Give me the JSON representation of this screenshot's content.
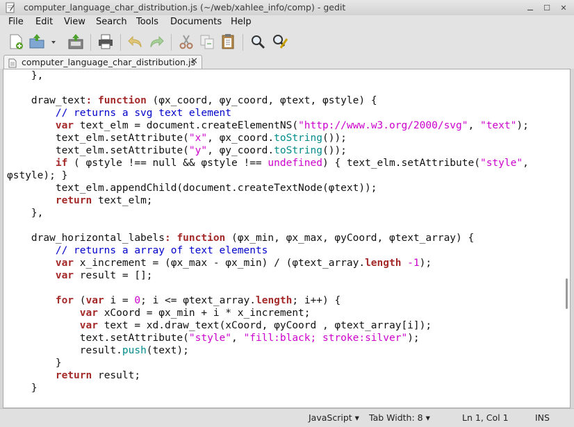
{
  "window": {
    "title": "computer_language_char_distribution.js (~/web/xahlee_info/comp) - gedit",
    "controls": {
      "minimize": "⚊",
      "maximize": "☐",
      "close": "✕"
    }
  },
  "menu": [
    "File",
    "Edit",
    "View",
    "Search",
    "Tools",
    "Documents",
    "Help"
  ],
  "toolbar": {
    "icons": [
      "new-document-icon",
      "open-icon",
      "dropdown-arrow-icon",
      "save-icon",
      "print-icon",
      "undo-icon",
      "redo-icon",
      "cut-icon",
      "copy-icon",
      "paste-icon",
      "find-icon",
      "find-replace-icon"
    ]
  },
  "tab": {
    "label": "computer_language_char_distribution.js",
    "close": "✕"
  },
  "code_lines": [
    [
      [
        "",
        "    },"
      ]
    ],
    [
      [
        "",
        ""
      ]
    ],
    [
      [
        "",
        "    draw_text"
      ],
      [
        "kw",
        ": function"
      ],
      [
        "",
        " (φx_coord, φy_coord, φtext, φstyle) {"
      ]
    ],
    [
      [
        "",
        "        "
      ],
      [
        "com",
        "// returns a svg text element"
      ]
    ],
    [
      [
        "",
        "        "
      ],
      [
        "kw",
        "var"
      ],
      [
        "",
        " text_elm = document.createElementNS("
      ],
      [
        "str",
        "\"http://www.w3.org/2000/svg\""
      ],
      [
        "",
        ", "
      ],
      [
        "str",
        "\"text\""
      ],
      [
        "",
        ");"
      ]
    ],
    [
      [
        "",
        "        text_elm.setAttribute("
      ],
      [
        "str",
        "\"x\""
      ],
      [
        "",
        ", φx_coord."
      ],
      [
        "prop",
        "toString"
      ],
      [
        "",
        "());"
      ]
    ],
    [
      [
        "",
        "        text_elm.setAttribute("
      ],
      [
        "str",
        "\"y\""
      ],
      [
        "",
        ", φy_coord."
      ],
      [
        "prop",
        "toString"
      ],
      [
        "",
        "());"
      ]
    ],
    [
      [
        "",
        "        "
      ],
      [
        "kw",
        "if"
      ],
      [
        "",
        " ( φstyle !== null && φstyle !== "
      ],
      [
        "str",
        "undefined"
      ],
      [
        "",
        ") { text_elm.setAttribute("
      ],
      [
        "str",
        "\"style\""
      ],
      [
        "",
        ","
      ]
    ],
    [
      [
        "",
        "φstyle); }"
      ]
    ],
    [
      [
        "",
        "        text_elm.appendChild(document.createTextNode(φtext));"
      ]
    ],
    [
      [
        "",
        "        "
      ],
      [
        "kw",
        "return"
      ],
      [
        "",
        " text_elm;"
      ]
    ],
    [
      [
        "",
        "    },"
      ]
    ],
    [
      [
        "",
        ""
      ]
    ],
    [
      [
        "",
        "    draw_horizontal_labels"
      ],
      [
        "kw",
        ": function"
      ],
      [
        "",
        " (φx_min, φx_max, φyCoord, φtext_array) {"
      ]
    ],
    [
      [
        "",
        "        "
      ],
      [
        "com",
        "// returns a array of text elements"
      ]
    ],
    [
      [
        "",
        "        "
      ],
      [
        "kw",
        "var"
      ],
      [
        "",
        " x_increment = (φx_max - φx_min) / (φtext_array."
      ],
      [
        "kw",
        "length"
      ],
      [
        "",
        " "
      ],
      [
        "num",
        "-1"
      ],
      [
        "",
        ");"
      ]
    ],
    [
      [
        "",
        "        "
      ],
      [
        "kw",
        "var"
      ],
      [
        "",
        " result = [];"
      ]
    ],
    [
      [
        "",
        ""
      ]
    ],
    [
      [
        "",
        "        "
      ],
      [
        "kw",
        "for"
      ],
      [
        "",
        " ("
      ],
      [
        "kw",
        "var"
      ],
      [
        "",
        " i = "
      ],
      [
        "num",
        "0"
      ],
      [
        "",
        "; i <= φtext_array."
      ],
      [
        "kw",
        "length"
      ],
      [
        "",
        "; i++) {"
      ]
    ],
    [
      [
        "",
        "            "
      ],
      [
        "kw",
        "var"
      ],
      [
        "",
        " xCoord = φx_min + i * x_increment;"
      ]
    ],
    [
      [
        "",
        "            "
      ],
      [
        "kw",
        "var"
      ],
      [
        "",
        " text = xd.draw_text(xCoord, φyCoord , φtext_array[i]);"
      ]
    ],
    [
      [
        "",
        "            text.setAttribute("
      ],
      [
        "str",
        "\"style\""
      ],
      [
        "",
        ", "
      ],
      [
        "str",
        "\"fill:black; stroke:silver\""
      ],
      [
        "",
        ");"
      ]
    ],
    [
      [
        "",
        "            result."
      ],
      [
        "prop",
        "push"
      ],
      [
        "",
        "(text);"
      ]
    ],
    [
      [
        "",
        "        }"
      ]
    ],
    [
      [
        "",
        "        "
      ],
      [
        "kw",
        "return"
      ],
      [
        "",
        " result;"
      ]
    ],
    [
      [
        "",
        "    }"
      ]
    ]
  ],
  "status": {
    "language": "JavaScript",
    "tab_width": "Tab Width:  8",
    "position": "Ln 1, Col 1",
    "mode": "INS",
    "dropdown_glyph": "▾"
  }
}
